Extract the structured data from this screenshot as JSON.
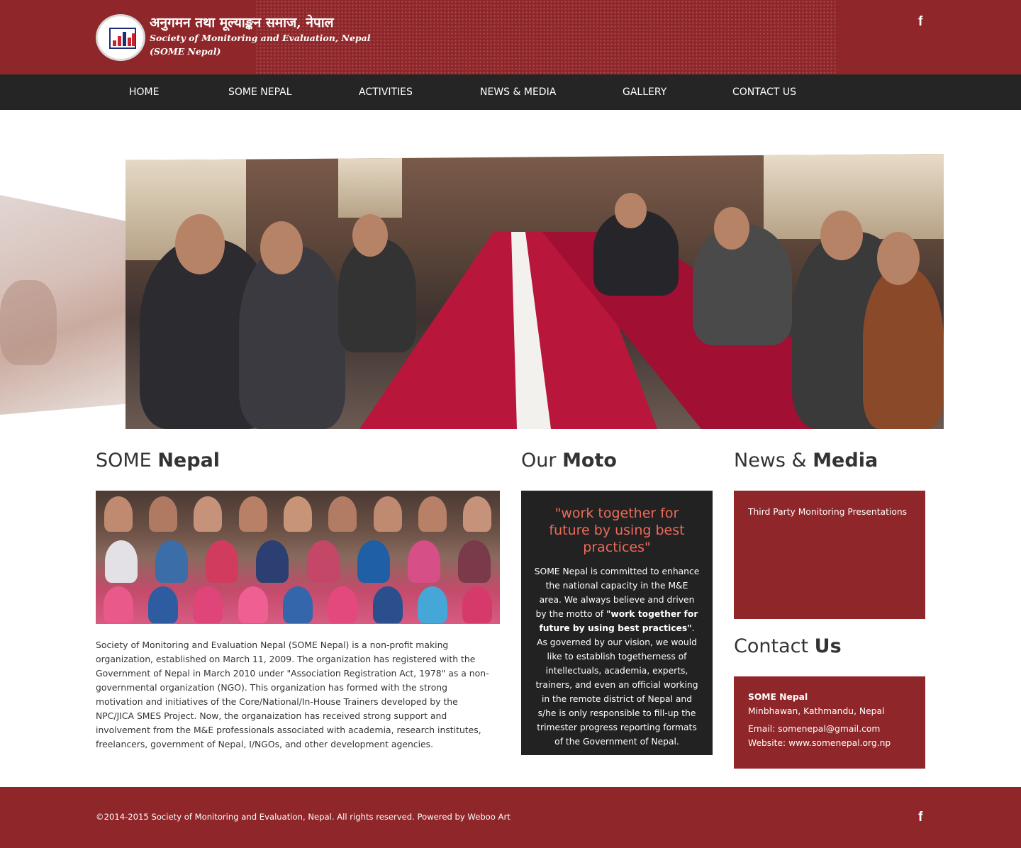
{
  "header": {
    "title_devanagari": "अनुगमन तथा मूल्याङ्कन समाज, नेपाल",
    "title_english": "Society of Monitoring and Evaluation, Nepal",
    "title_short": "(SOME Nepal)",
    "social_icon": "f"
  },
  "nav": {
    "items": [
      {
        "label": "Home"
      },
      {
        "label": "SOME Nepal"
      },
      {
        "label": "Activities"
      },
      {
        "label": "News & Media"
      },
      {
        "label": "Gallery"
      },
      {
        "label": "Contact Us"
      }
    ]
  },
  "about": {
    "title_light": "SOME ",
    "title_bold": "Nepal",
    "body": "Society of Monitoring and Evaluation Nepal (SOME Nepal) is a non-profit making organization, established on March 11, 2009. The organization has registered with the Government of Nepal in March 2010 under \"Association Registration Act, 1978\" as a non-governmental organization (NGO). This organization has formed with the strong motivation and initiatives of the Core/National/In-House Trainers developed by the NPC/JICA SMES Project. Now, the organaization has received strong support and involvement from the M&E professionals associated with academia, research institutes, freelancers, government of Nepal, I/NGOs, and other development agencies."
  },
  "moto": {
    "title_light": "Our ",
    "title_bold": "Moto",
    "quote": "\"work together for future by using best practices\"",
    "text_part1": "SOME Nepal is committed to enhance the national capacity in the M&E area. We always believe and driven by the motto of ",
    "text_bold": "\"work together for future by using best practices\"",
    "text_part2": ". As governed by our vision, we would like to establish togetherness of intellectuals, academia, experts, trainers, and even an official working in the remote district of Nepal and s/he is only responsible to fill-up the trimester progress reporting formats of the Government of Nepal."
  },
  "news": {
    "title_light": "News & ",
    "title_bold": "Media",
    "items": [
      "Third Party Monitoring Presentations"
    ]
  },
  "contact": {
    "title_light": "Contact ",
    "title_bold": "Us",
    "org": "SOME Nepal",
    "address": "Minbhawan, Kathmandu, Nepal",
    "email": "Email: somenepal@gmail.com",
    "website": "Website: www.somenepal.org.np"
  },
  "footer": {
    "copyright": "©2014-2015 Society of Monitoring and Evaluation, Nepal. All rights reserved. Powered by Weboo Art",
    "social_icon": "f"
  },
  "colors": {
    "brand_red": "#8f2629",
    "nav_dark": "#252525",
    "moto_box": "#222222",
    "quote_accent": "#ef6a5a"
  }
}
